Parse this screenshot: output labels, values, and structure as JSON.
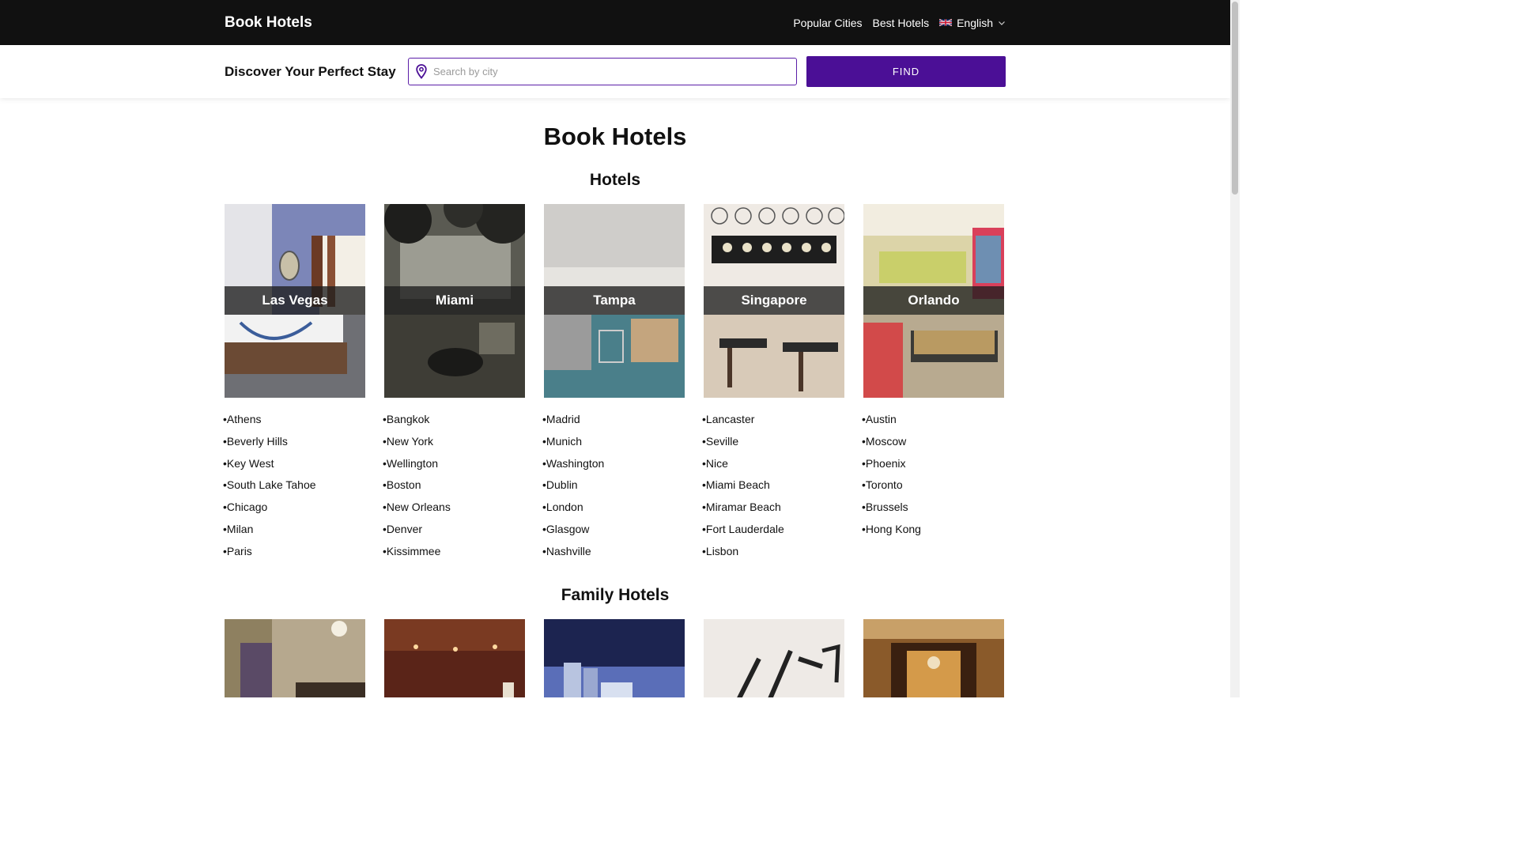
{
  "header": {
    "brand": "Book Hotels",
    "nav": [
      "Popular Cities",
      "Best Hotels"
    ],
    "language": "English"
  },
  "search": {
    "tagline": "Discover Your Perfect Stay",
    "placeholder": "Search by city",
    "button_label": "FIND"
  },
  "main": {
    "title": "Book Hotels",
    "hotels_heading": "Hotels",
    "family_heading": "Family Hotels"
  },
  "hotels": [
    {
      "city": "Las Vegas",
      "links": [
        "Athens",
        "Beverly Hills",
        "Key West",
        "South Lake Tahoe",
        "Chicago",
        "Milan",
        "Paris"
      ]
    },
    {
      "city": "Miami",
      "links": [
        "Bangkok",
        "New York",
        "Wellington",
        "Boston",
        "New Orleans",
        "Denver",
        "Kissimmee"
      ]
    },
    {
      "city": "Tampa",
      "links": [
        "Madrid",
        "Munich",
        "Washington",
        "Dublin",
        "London",
        "Glasgow",
        "Nashville"
      ]
    },
    {
      "city": "Singapore",
      "links": [
        "Lancaster",
        "Seville",
        "Nice",
        "Miami Beach",
        "Miramar Beach",
        "Fort Lauderdale",
        "Lisbon"
      ]
    },
    {
      "city": "Orlando",
      "links": [
        "Austin",
        "Moscow",
        "Phoenix",
        "Toronto",
        "Brussels",
        "Hong Kong"
      ]
    }
  ],
  "colors": {
    "accent": "#4b0f96",
    "topbar": "#111111"
  }
}
